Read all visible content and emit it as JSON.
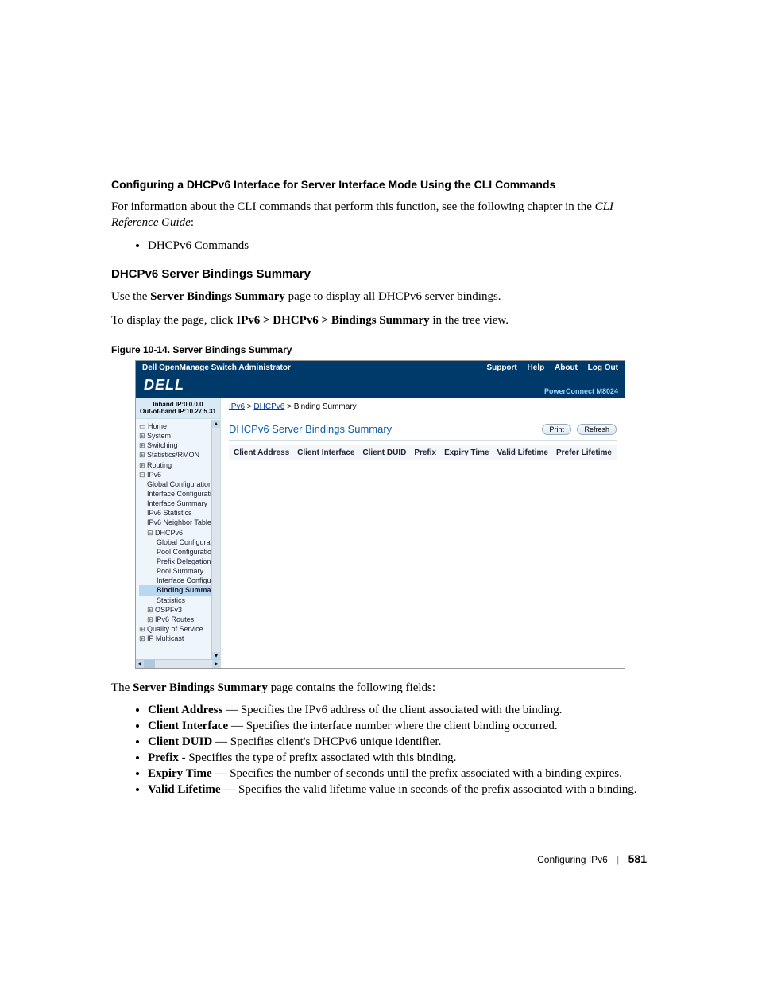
{
  "section1": {
    "heading": "Configuring a DHCPv6 Interface for Server Interface Mode Using the CLI Commands",
    "para_a": "For information about the CLI commands that perform this function, see the following chapter in the ",
    "para_b": "CLI Reference Guide",
    "para_c": ":",
    "bullet1": "DHCPv6 Commands"
  },
  "section2": {
    "heading": "DHCPv6 Server Bindings Summary",
    "para1_a": "Use the ",
    "para1_b": "Server Bindings Summary",
    "para1_c": " page to display all DHCPv6 server bindings.",
    "para2_a": "To display the page, click ",
    "para2_b": "IPv6 > DHCPv6 > Bindings Summary",
    "para2_c": " in the tree view."
  },
  "figure": {
    "caption": "Figure 10-14.    Server Bindings Summary",
    "titlebar": {
      "left": "Dell OpenManage Switch Administrator",
      "support": "Support",
      "help": "Help",
      "about": "About",
      "logout": "Log Out"
    },
    "logo": "DELL",
    "model": "PowerConnect M8024",
    "ip1": "Inband IP:0.0.0.0",
    "ip2": "Out-of-band IP:10.27.5.31",
    "tree": {
      "home": "Home",
      "system": "System",
      "switching": "Switching",
      "stats": "Statistics/RMON",
      "routing": "Routing",
      "ipv6": "IPv6",
      "gconf": "Global Configuration",
      "iconf": "Interface Configuratio",
      "isum": "Interface Summary",
      "ipv6stats": "IPv6 Statistics",
      "neigh": "IPv6 Neighbor Table",
      "dhcpv6": "DHCPv6",
      "dgconf": "Global Configuratio",
      "poolconf": "Pool Configuration",
      "prefixdel": "Prefix Delegation C",
      "poolsum": "Pool Summary",
      "ifaceconf": "Interface Configura",
      "bindsum": "Binding Summar",
      "statsnode": "Statistics",
      "ospf": "OSPFv3",
      "routes": "IPv6 Routes",
      "qos": "Quality of Service",
      "ipmc": "IP Multicast"
    },
    "crumb": {
      "ipv6": "IPv6",
      "dhcpv6": "DHCPv6",
      "last": "Binding Summary"
    },
    "panel": {
      "title": "DHCPv6 Server Bindings Summary",
      "print": "Print",
      "refresh": "Refresh"
    },
    "cols": {
      "c1": "Client Address",
      "c2": "Client Interface",
      "c3": "Client DUID",
      "c4": "Prefix",
      "c5": "Expiry Time",
      "c6": "Valid Lifetime",
      "c7": "Prefer Lifetime"
    }
  },
  "after": {
    "para_a": "The ",
    "para_b": "Server Bindings Summary",
    "para_c": " page contains the following fields:",
    "items": [
      {
        "term": "Client Address",
        "sep": " — ",
        "desc": "Specifies the IPv6 address of the client associated with the binding."
      },
      {
        "term": "Client Interface",
        "sep": " — ",
        "desc": "Specifies the interface number where the client binding occurred."
      },
      {
        "term": "Client DUID",
        "sep": " — ",
        "desc": "Specifies client's DHCPv6 unique identifier."
      },
      {
        "term": "Prefix",
        "sep": " - ",
        "desc": "Specifies the type of prefix associated with this binding."
      },
      {
        "term": "Expiry Time",
        "sep": " — ",
        "desc": "Specifies the number of seconds until the prefix associated with a binding expires."
      },
      {
        "term": "Valid Lifetime",
        "sep": " — ",
        "desc": "Specifies the valid lifetime value in seconds of the prefix associated with a binding."
      }
    ]
  },
  "footer": {
    "chapter": "Configuring IPv6",
    "page": "581"
  }
}
